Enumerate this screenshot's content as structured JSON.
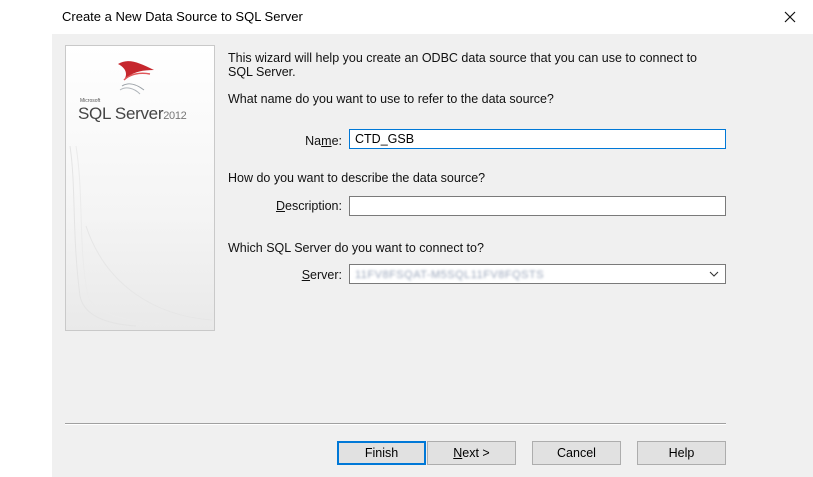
{
  "window": {
    "title": "Create a New Data Source to SQL Server",
    "close_icon": "close-icon"
  },
  "banner": {
    "ms": "Microsoft",
    "product": "SQL Server",
    "version": "2012"
  },
  "intro": {
    "line1": "This wizard will help you create an ODBC data source that you can use to connect to",
    "line2": "SQL Server."
  },
  "name_question": "What name do you want to use to refer to the data source?",
  "name_label_pre": "Na",
  "name_label_acc": "m",
  "name_label_post": "e:",
  "name_value": "CTD_GSB",
  "desc_question": "How do you want to describe the data source?",
  "desc_label_acc": "D",
  "desc_label_post": "escription:",
  "desc_value": "",
  "server_question": "Which SQL Server do you want to connect to?",
  "server_label_acc": "S",
  "server_label_post": "erver:",
  "server_value": "11FV8FSQAT-M5SQL11FV8FQSTS",
  "buttons": {
    "finish": "Finish",
    "next_acc": "N",
    "next_post": "ext >",
    "cancel": "Cancel",
    "help": "Help"
  }
}
